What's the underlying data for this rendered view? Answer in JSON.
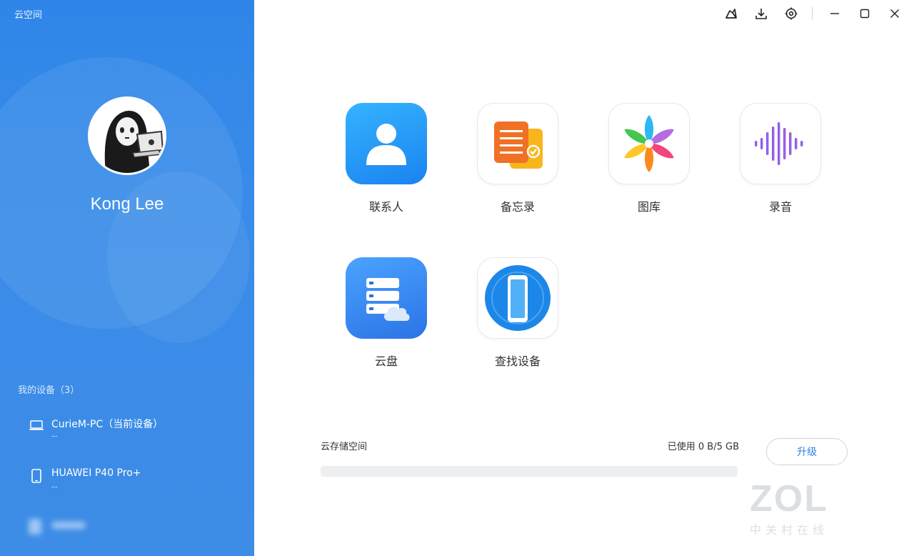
{
  "window": {
    "title": "云空间"
  },
  "user": {
    "name": "Kong Lee"
  },
  "devices": {
    "header": "我的设备（3）",
    "items": [
      {
        "name": "CurieM-PC（当前设备）",
        "sub": "--",
        "icon": "laptop-icon"
      },
      {
        "name": "HUAWEI P40 Pro+",
        "sub": "--",
        "icon": "phone-icon"
      }
    ]
  },
  "toolbar": {
    "icons": [
      "cleanup-icon",
      "download-icon",
      "settings-icon",
      "minimize-icon",
      "maximize-icon",
      "close-icon"
    ]
  },
  "apps": [
    {
      "label": "联系人",
      "icon": "contacts-icon"
    },
    {
      "label": "备忘录",
      "icon": "notes-icon"
    },
    {
      "label": "图库",
      "icon": "gallery-icon"
    },
    {
      "label": "录音",
      "icon": "recorder-icon"
    },
    {
      "label": "云盘",
      "icon": "cloud-drive-icon"
    },
    {
      "label": "查找设备",
      "icon": "find-device-icon"
    }
  ],
  "storage": {
    "label": "云存储空间",
    "used_text": "已使用 0 B/5 GB",
    "used_fraction": 0,
    "upgrade_label": "升级"
  },
  "watermark": {
    "logo": "ZOL",
    "sub": "中关村在线"
  },
  "colors": {
    "accent": "#3a8ce9",
    "sidebar": "#2f86e8"
  }
}
